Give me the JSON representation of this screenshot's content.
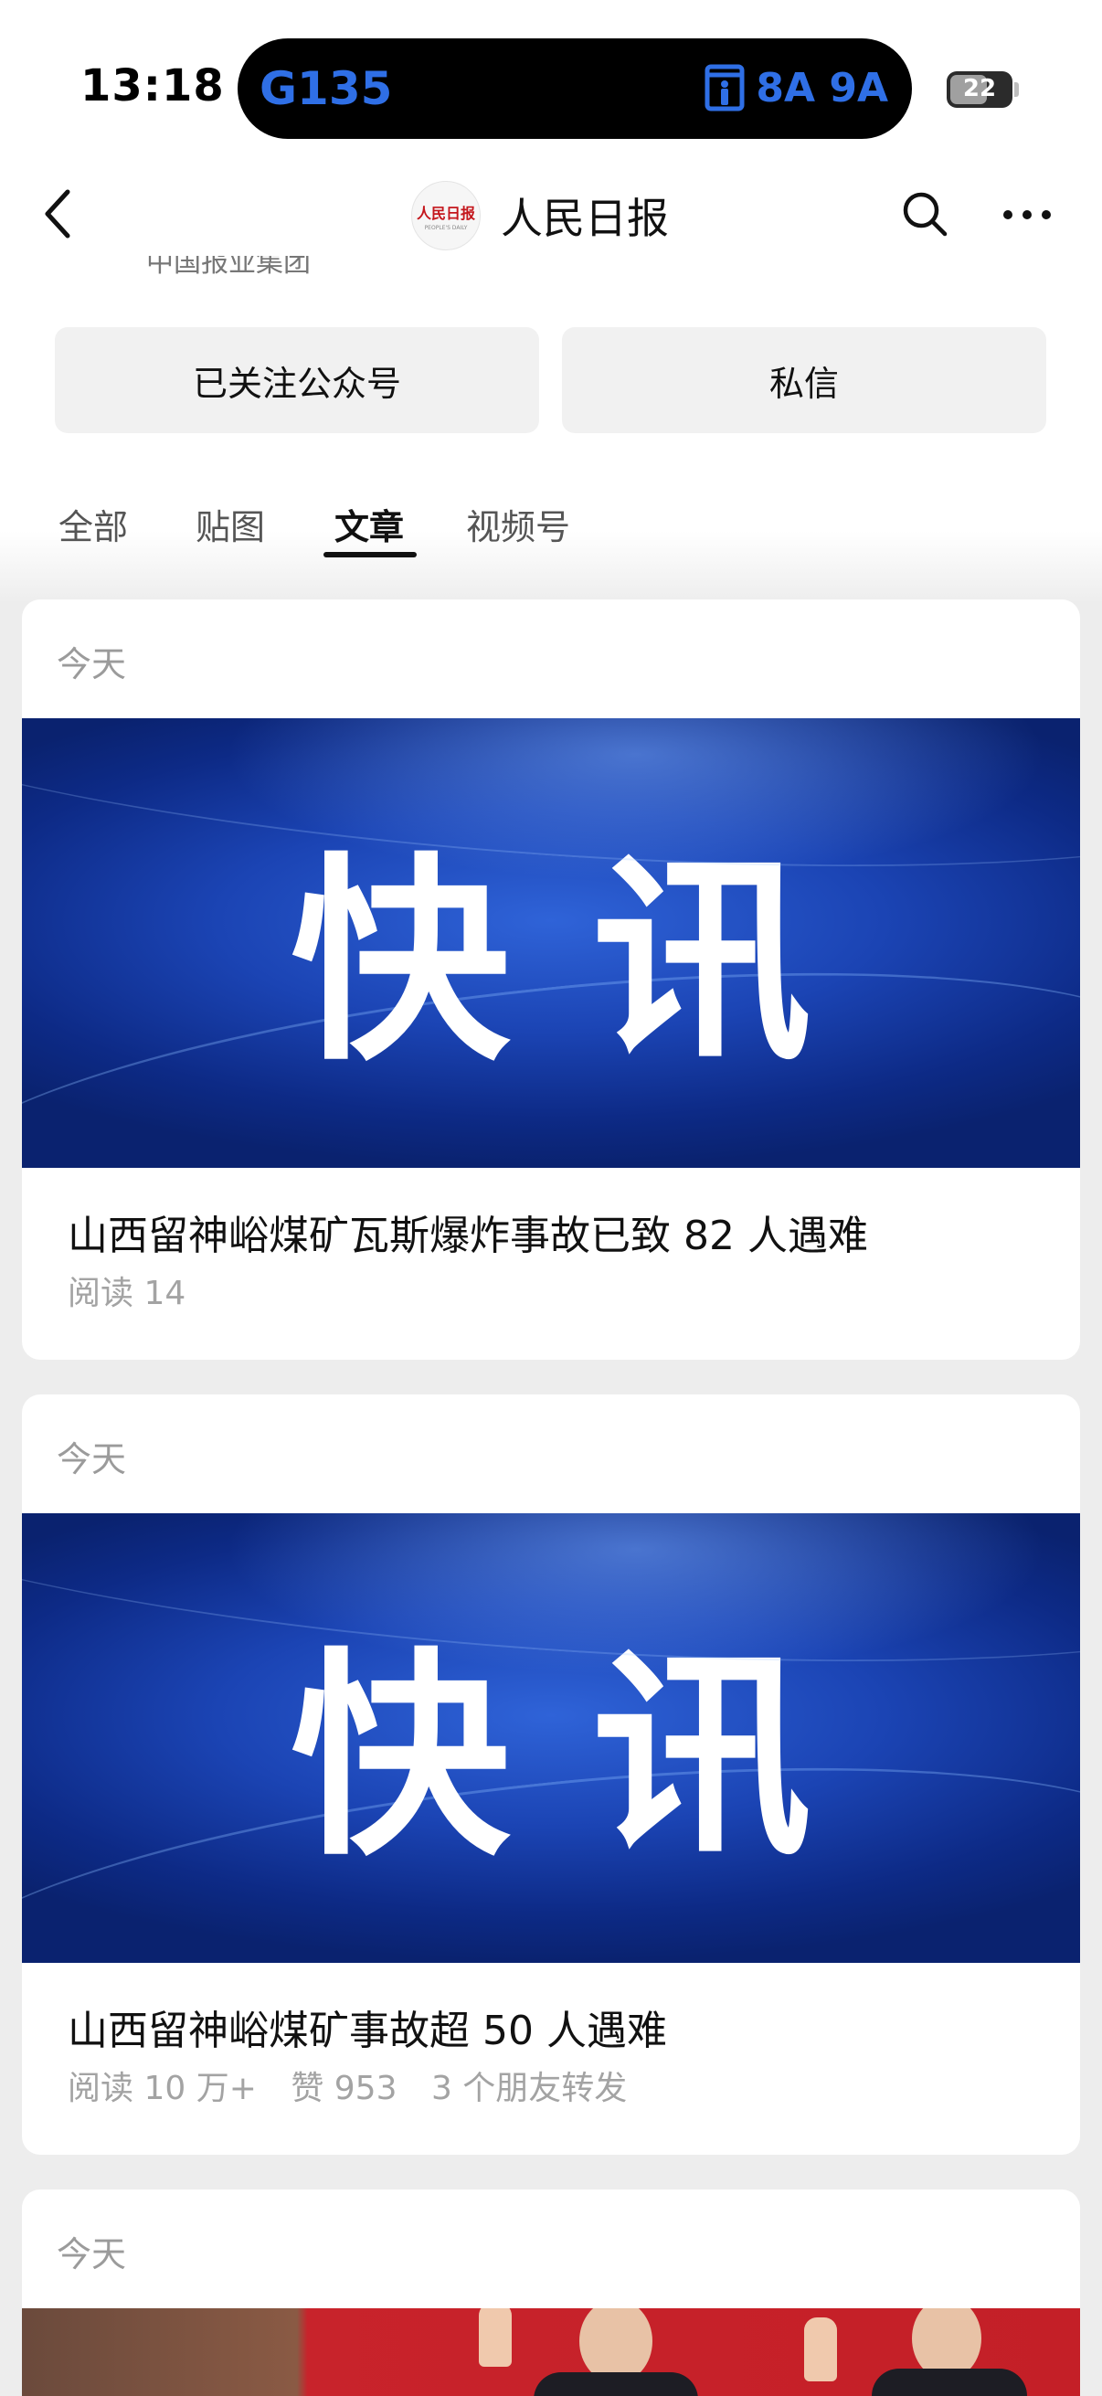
{
  "status_bar": {
    "time": "13:18",
    "live_activity": {
      "train": "G135",
      "icon": "train-door-icon",
      "gates": "8A 9A",
      "color": "#2f6fe6"
    },
    "battery": "22"
  },
  "nav": {
    "back_icon": "chevron-left-icon",
    "logo": {
      "cn": "人民日报",
      "en": "PEOPLE'S DAILY"
    },
    "title": "人民日报",
    "search_icon": "search-icon",
    "more_icon": "more-horizontal-icon"
  },
  "truncated_text": "中国报业集团",
  "actions": {
    "follow_label": "已关注公众号",
    "message_label": "私信"
  },
  "tabs": [
    {
      "label": "全部",
      "active": false
    },
    {
      "label": "贴图",
      "active": false
    },
    {
      "label": "文章",
      "active": true
    },
    {
      "label": "视频号",
      "active": false
    }
  ],
  "articles": [
    {
      "date": "今天",
      "banner_text": "快讯",
      "title": "山西留神峪煤矿瓦斯爆炸事故已致 82 人遇难",
      "meta": [
        "阅读 14"
      ]
    },
    {
      "date": "今天",
      "banner_text": "快讯",
      "title": "山西留神峪煤矿事故超 50 人遇难",
      "meta": [
        "阅读 10 万+",
        "赞 953",
        "3 个朋友转发"
      ]
    },
    {
      "date": "今天"
    }
  ],
  "colors": {
    "background": "#ededed",
    "card": "#ffffff",
    "banner_blue": "#1b44b4",
    "muted_text": "#9b9b9b"
  }
}
